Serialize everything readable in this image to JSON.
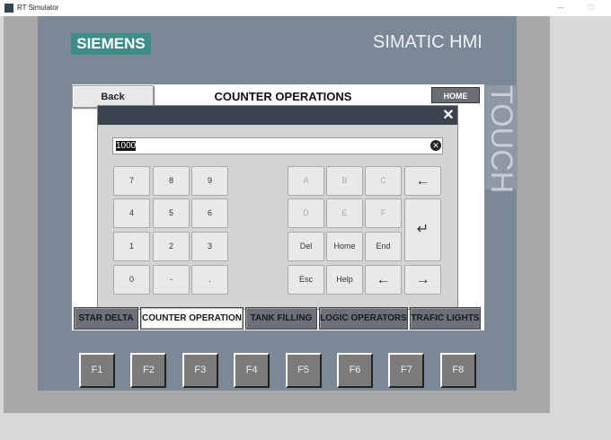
{
  "window": {
    "title": "RT Simulator",
    "minimize": "—",
    "maximize": "☐"
  },
  "brand": {
    "logo": "SIEMENS",
    "product": "SIMATIC HMI",
    "panel_label": "TOUCH"
  },
  "header": {
    "back": "Back",
    "title": "COUNTER OPERATIONS",
    "home": "HOME"
  },
  "keypad": {
    "close": "✕",
    "value": "1000",
    "clear": "✕",
    "numeric": [
      "7",
      "8",
      "9",
      "4",
      "5",
      "6",
      "1",
      "2",
      "3",
      "0",
      "-",
      "."
    ],
    "alpha": [
      "A",
      "B",
      "C",
      "←",
      "D",
      "E",
      "F",
      "Del",
      "Home",
      "End",
      "Esc",
      "Help",
      "←",
      "→"
    ],
    "enter": "↵"
  },
  "tabs": [
    {
      "label": "STAR DELTA"
    },
    {
      "label": "COUNTER OPERATION",
      "active": true
    },
    {
      "label": "TANK FILLING"
    },
    {
      "label": "LOGIC OPERATORS"
    },
    {
      "label": "TRAFIC LIGHTS"
    }
  ],
  "fkeys": [
    "F1",
    "F2",
    "F3",
    "F4",
    "F5",
    "F6",
    "F7",
    "F8"
  ]
}
